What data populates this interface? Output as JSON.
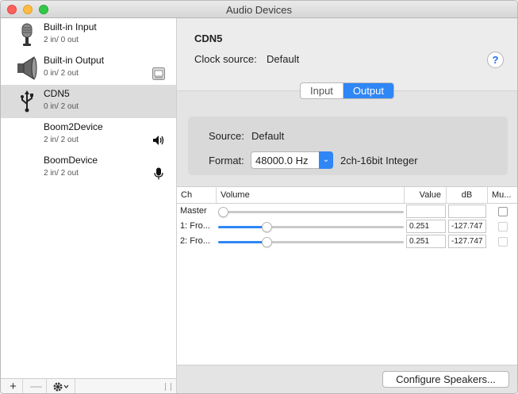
{
  "window": {
    "title": "Audio Devices"
  },
  "devices": [
    {
      "name": "Built-in Input",
      "io": "2 in/ 0 out",
      "icon": "microphone-icon",
      "selected": false
    },
    {
      "name": "Built-in Output",
      "io": "0 in/ 2 out",
      "icon": "speaker-icon",
      "selected": false
    },
    {
      "name": "CDN5",
      "io": "0 in/ 2 out",
      "icon": "usb-icon",
      "selected": true
    },
    {
      "name": "Boom2Device",
      "io": "2 in/ 2 out",
      "icon": "",
      "selected": false
    },
    {
      "name": "BoomDevice",
      "io": "2 in/ 2 out",
      "icon": "",
      "selected": false
    }
  ],
  "sidebar_footer": {
    "add": "+",
    "remove": "—"
  },
  "detail": {
    "device_title": "CDN5",
    "clock_label": "Clock source:",
    "clock_value": "Default",
    "help": "?"
  },
  "tabs": {
    "input": "Input",
    "output": "Output",
    "active": "Output"
  },
  "format_box": {
    "source_label": "Source:",
    "source_value": "Default",
    "format_label": "Format:",
    "format_value": "48000.0 Hz",
    "format_extra": "2ch-16bit Integer"
  },
  "table": {
    "headers": {
      "ch": "Ch",
      "volume": "Volume",
      "value": "Value",
      "db": "dB",
      "mute": "Mu..."
    },
    "rows": [
      {
        "ch": "Master",
        "level": 0.0,
        "value": "",
        "db": "",
        "muted": false
      },
      {
        "ch": "1: Fro...",
        "level": 0.251,
        "value": "0.251",
        "db": "-127.747",
        "muted": false
      },
      {
        "ch": "2: Fro...",
        "level": 0.251,
        "value": "0.251",
        "db": "-127.747",
        "muted": false
      }
    ]
  },
  "configure_button": "Configure Speakers...",
  "colors": {
    "accent": "#2f86f5",
    "selected_row": "#dcdcdc"
  }
}
